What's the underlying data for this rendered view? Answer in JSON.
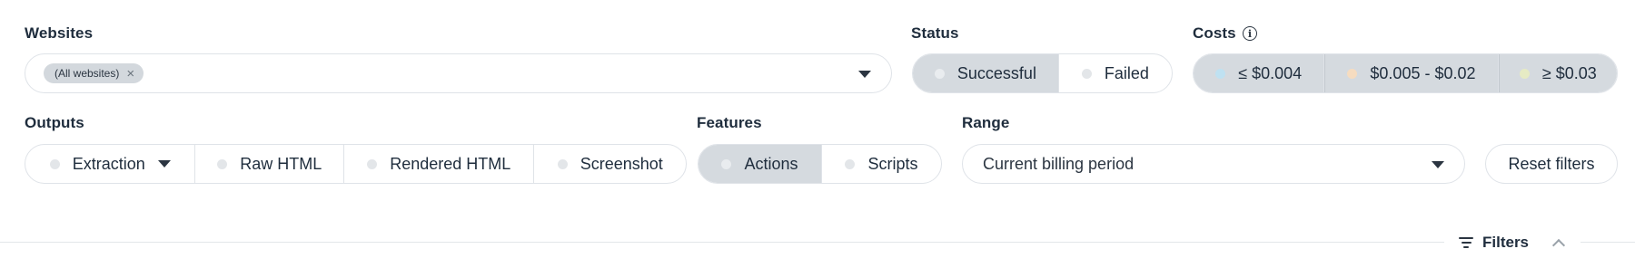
{
  "websites": {
    "label": "Websites",
    "chip": "(All websites)",
    "chip_remove": "×"
  },
  "status": {
    "label": "Status",
    "options": [
      {
        "label": "Successful",
        "active": true
      },
      {
        "label": "Failed",
        "active": false
      }
    ]
  },
  "costs": {
    "label": "Costs",
    "info": "i",
    "options": [
      {
        "label": "≤ $0.004",
        "dot_color": "#bfe1f1",
        "active": true
      },
      {
        "label": "$0.005 - $0.02",
        "dot_color": "#f6dcc0",
        "active": true
      },
      {
        "label": "≥ $0.03",
        "dot_color": "#e6ebc4",
        "active": true
      }
    ]
  },
  "outputs": {
    "label": "Outputs",
    "options": [
      {
        "label": "Extraction",
        "dropdown": true
      },
      {
        "label": "Raw HTML"
      },
      {
        "label": "Rendered HTML"
      },
      {
        "label": "Screenshot"
      }
    ]
  },
  "features": {
    "label": "Features",
    "options": [
      {
        "label": "Actions",
        "active": true
      },
      {
        "label": "Scripts",
        "active": false
      }
    ]
  },
  "range": {
    "label": "Range",
    "value": "Current billing period"
  },
  "reset_label": "Reset filters",
  "filters_label": "Filters",
  "icons": {
    "info": "info-icon",
    "caret": "caret-down-icon",
    "filter": "filter-icon",
    "collapse": "chevron-up-icon",
    "remove": "close-icon"
  }
}
